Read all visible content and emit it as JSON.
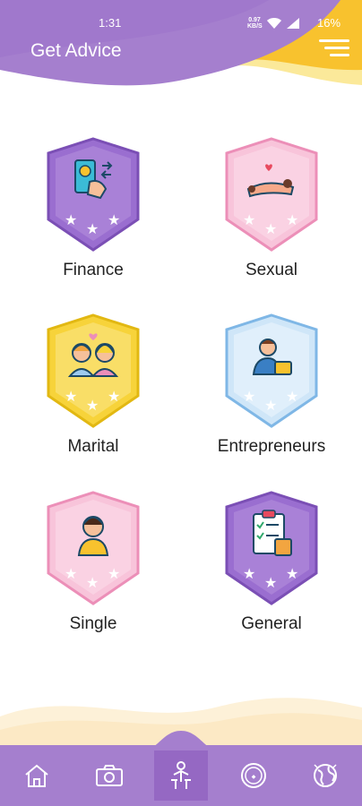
{
  "status_bar": {
    "time": "1:31",
    "network_speed": "0.97\nKB/S",
    "battery": "16%"
  },
  "header": {
    "title": "Get Advice",
    "menu_icon": "hamburger-menu-icon"
  },
  "categories": [
    {
      "label": "Finance",
      "icon": "finance-icon",
      "color": "#9a6ed0"
    },
    {
      "label": "Sexual",
      "icon": "couple-icon",
      "color": "#f1a2c8"
    },
    {
      "label": "Marital",
      "icon": "married-couple-icon",
      "color": "#f7d33a"
    },
    {
      "label": "Entrepreneurs",
      "icon": "entrepreneur-icon",
      "color": "#9ecbef"
    },
    {
      "label": "Single",
      "icon": "single-person-icon",
      "color": "#f1a2c8"
    },
    {
      "label": "General",
      "icon": "clipboard-checklist-icon",
      "color": "#9a6ed0"
    }
  ],
  "bottom_nav": [
    {
      "icon": "home-icon",
      "active": false
    },
    {
      "icon": "camera-icon",
      "active": false
    },
    {
      "icon": "advice-person-icon",
      "active": true
    },
    {
      "icon": "badge-icon",
      "active": false
    },
    {
      "icon": "globe-world-icon",
      "active": false
    }
  ],
  "colors": {
    "primary": "#a57fce",
    "accent_yellow": "#f8c22e",
    "background": "#ffffff"
  }
}
